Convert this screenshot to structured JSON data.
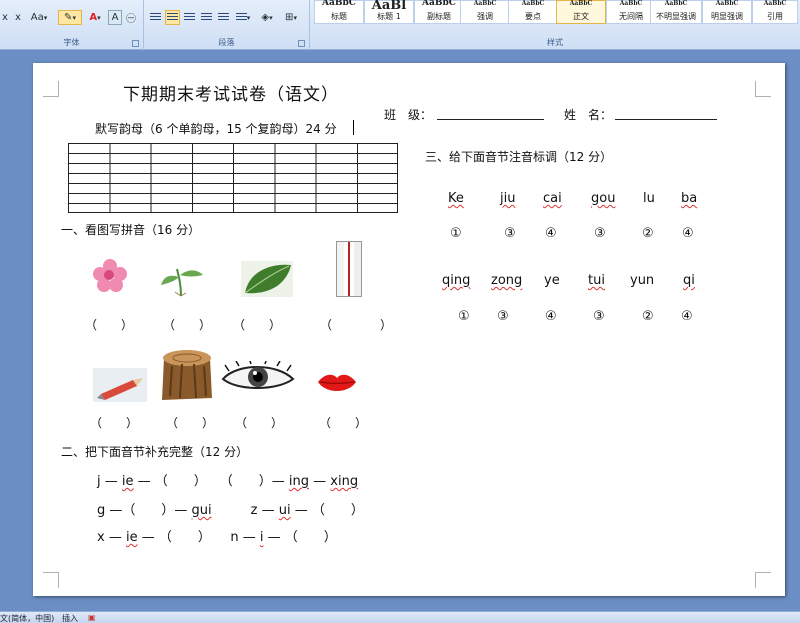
{
  "ribbon": {
    "font_group_label": "字体",
    "paragraph_group_label": "段落",
    "styles_group_label": "样式",
    "font_buttons": [
      "x",
      "x",
      "Aa",
      "A",
      "A"
    ],
    "styles": [
      {
        "sample": "AaBbC",
        "name": "标题"
      },
      {
        "sample": "AaBl",
        "name": "标题 1"
      },
      {
        "sample": "AaBbC",
        "name": "副标题"
      },
      {
        "sample": "AaBbC",
        "name": "强调"
      },
      {
        "sample": "AaBbC",
        "name": "要点"
      },
      {
        "sample": "AaBbC",
        "name": "正文"
      },
      {
        "sample": "AaBbC",
        "name": "无间隔"
      },
      {
        "sample": "AaBbC",
        "name": "不明显强调"
      },
      {
        "sample": "AaBbC",
        "name": "明显强调"
      },
      {
        "sample": "AaBbC",
        "name": "引用"
      }
    ],
    "accent_color": "#fde7a3",
    "font_color": "#e02020"
  },
  "document": {
    "title": "下期期末考试试卷（语文）",
    "class_label": "班　级：",
    "name_label": "姓　名：",
    "dictation": "默写韵母（6 个单韵母，15 个复韵母）24 分",
    "section1": "一、看图写拼音（16 分）",
    "section2": "二、把下面音节补充完整（12 分）",
    "section3": "三、给下面音节注音标调（12 分）",
    "paren_row1": [
      "（　　）",
      "（　　）",
      "（　　）",
      "（　　　　）"
    ],
    "paren_row2": [
      "（　　）",
      "（　　）",
      "（　　）",
      "（　　）"
    ],
    "fill_lines": [
      {
        "a": "j — ",
        "b": "ie",
        "c": " — （　　）　　（　　）— ",
        "d": "ing",
        "e": " — ",
        "f": "xing"
      },
      {
        "a": "g —（　　）— ",
        "b": "gui",
        "c": "　　　z — ",
        "d": "ui",
        "e": " — （　　）",
        "f": ""
      },
      {
        "a": "x — ",
        "b": "ie",
        "c": " — （　　）　　n — ",
        "d": "i",
        "e": " — （　　）",
        "f": ""
      }
    ],
    "tone_row1": [
      "Ke",
      "jiu",
      "cai",
      "gou",
      "lu",
      "ba"
    ],
    "tone_nums1": [
      "①",
      "③",
      "④",
      "③",
      "②",
      "④"
    ],
    "tone_row2": [
      "qing",
      "zong",
      "ye",
      "tui",
      "yun",
      "qi"
    ],
    "tone_nums2": [
      "①",
      "③",
      "④",
      "③",
      "②",
      "④"
    ]
  },
  "status_bar": {
    "language": "文(简体，中国)",
    "mode": "插入"
  }
}
